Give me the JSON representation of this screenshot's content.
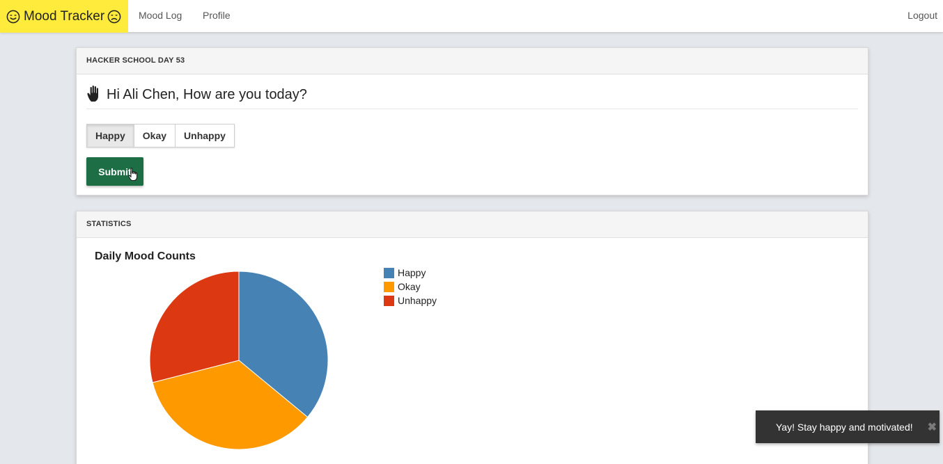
{
  "navbar": {
    "brand": "Mood Tracker",
    "brand_left_icon": "smiley-icon",
    "brand_right_icon": "sad-face-icon",
    "links": [
      "Mood Log",
      "Profile"
    ],
    "logout": "Logout",
    "brand_color": "#ffeb3b"
  },
  "checkin": {
    "heading": "HACKER SCHOOL DAY 53",
    "greeting": "Hi Ali Chen, How are you today?",
    "greeting_icon": "raised-hand-icon",
    "options": [
      "Happy",
      "Okay",
      "Unhappy"
    ],
    "selected": "Happy",
    "submit_label": "Submit",
    "submit_color": "#1d6e45"
  },
  "statistics": {
    "heading": "STATISTICS"
  },
  "chart_data": {
    "type": "pie",
    "title": "Daily Mood Counts",
    "categories": [
      "Happy",
      "Okay",
      "Unhappy"
    ],
    "values": [
      36,
      35,
      29
    ],
    "colors": [
      "#4682b4",
      "#ff9900",
      "#dc3912"
    ],
    "legend_position": "right"
  },
  "toast": {
    "message": "Yay! Stay happy and motivated!",
    "close_icon": "close-icon"
  }
}
